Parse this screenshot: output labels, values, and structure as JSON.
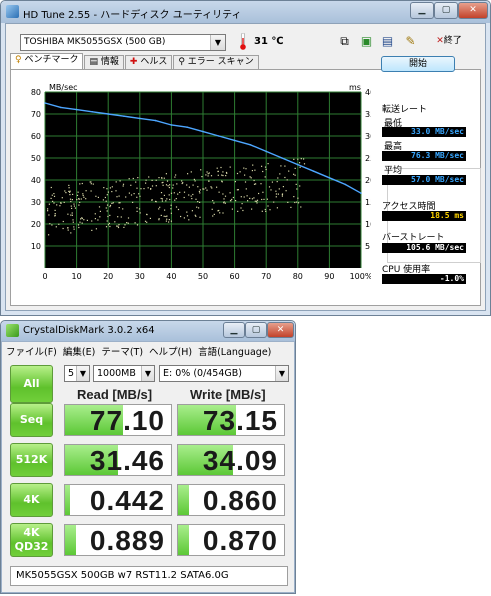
{
  "hdtune": {
    "title": "HD Tune 2.55 - ハードディスク ユーティリティ",
    "drive": "TOSHIBA MK5055GSX (500 GB)",
    "temperature": "31 ℃",
    "exit_label": "終了",
    "tabs": [
      "ベンチマーク",
      "情報",
      "ヘルス",
      "エラー スキャン"
    ],
    "start_label": "開始",
    "transfer_rate_label": "転送レート",
    "min_label": "最低",
    "min_value": "33.0 MB/sec",
    "max_label": "最高",
    "max_value": "76.3 MB/sec",
    "avg_label": "平均",
    "avg_value": "57.0 MB/sec",
    "access_label": "アクセス時間",
    "access_value": "18.5 ms",
    "burst_label": "バーストレート",
    "burst_value": "105.6 MB/sec",
    "cpu_label": "CPU 使用率",
    "cpu_value": "-1.0%",
    "colors": {
      "plot_bg": "#000000",
      "grid": "#2e7d32",
      "transfer_line": "#4da6ff",
      "access_dots": "#d8d8a8",
      "value_text": "#39a7ff"
    }
  },
  "chart_data": {
    "type": "line",
    "xlabel": "",
    "x_ticks": [
      "0",
      "10",
      "20",
      "30",
      "40",
      "50",
      "60",
      "70",
      "80",
      "90",
      "100%"
    ],
    "y_left_label": "MB/sec",
    "y_left_ticks": [
      "80",
      "70",
      "60",
      "50",
      "40",
      "30",
      "20",
      "10"
    ],
    "y_right_label": "ms",
    "y_right_ticks": [
      "40",
      "35",
      "30",
      "25",
      "20",
      "15",
      "10",
      "5"
    ],
    "ylim": [
      0,
      80
    ],
    "y2lim": [
      0,
      40
    ],
    "grid": true,
    "series": [
      {
        "x": [
          0,
          5,
          10,
          15,
          20,
          25,
          30,
          35,
          40,
          45,
          50,
          55,
          60,
          65,
          70,
          75,
          80,
          85,
          90,
          95,
          100
        ],
        "values": [
          75,
          73,
          72,
          71,
          70,
          69,
          68,
          67,
          65,
          64,
          62,
          60,
          58,
          56,
          53,
          50,
          47,
          44,
          41,
          38,
          34
        ]
      }
    ]
  },
  "cdm": {
    "title": "CrystalDiskMark 3.0.2 x64",
    "menu": [
      "ファイル(F)",
      "編集(E)",
      "テーマ(T)",
      "ヘルプ(H)",
      "言語(Language)"
    ],
    "all_label": "All",
    "count": "5",
    "size": "1000MB",
    "drive": "E: 0% (0/454GB)",
    "read_header": "Read [MB/s]",
    "write_header": "Write [MB/s]",
    "rows": [
      {
        "label": "Seq",
        "read": "77.10",
        "write": "73.15",
        "read_level": 0.55,
        "write_level": 0.55
      },
      {
        "label": "512K",
        "read": "31.46",
        "write": "34.09",
        "read_level": 0.5,
        "write_level": 0.52
      },
      {
        "label": "4K",
        "read": "0.442",
        "write": "0.860",
        "read_level": 0.05,
        "write_level": 0.1
      },
      {
        "label": "4K\nQD32",
        "read": "0.889",
        "write": "0.870",
        "read_level": 0.1,
        "write_level": 0.1
      }
    ],
    "comment": "MK5055GSX 500GB w7 RST11.2 SATA6.0G"
  }
}
